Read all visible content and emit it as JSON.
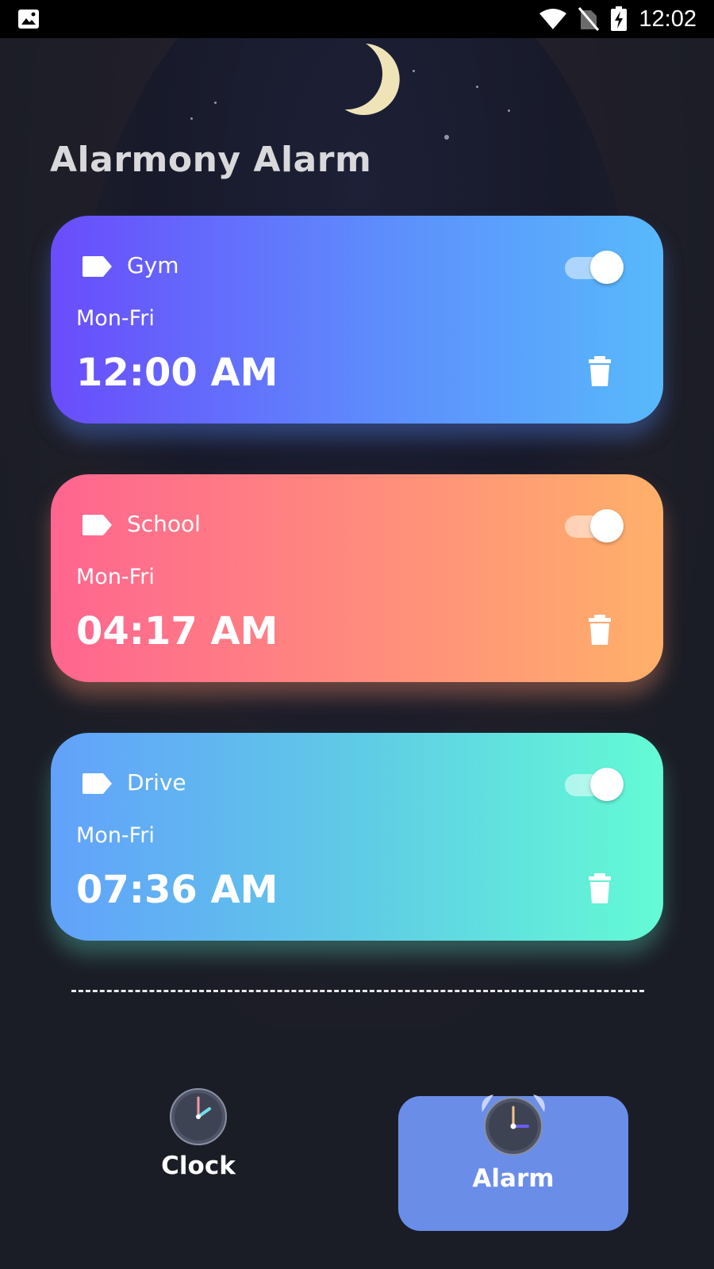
{
  "status_bar": {
    "time": "12:02",
    "icons": [
      "image-icon",
      "wifi-icon",
      "no-sim-icon",
      "battery-charging-icon"
    ]
  },
  "app": {
    "title": "Alarmony Alarm"
  },
  "alarms": [
    {
      "label": "Gym",
      "days": "Mon-Fri",
      "time": "12:00 AM",
      "enabled": true,
      "colors": [
        "#6a4cfb",
        "#58b9fb"
      ]
    },
    {
      "label": "School",
      "days": "Mon-Fri",
      "time": "04:17 AM",
      "enabled": true,
      "colors": [
        "#ff6590",
        "#ffb06a"
      ]
    },
    {
      "label": "Drive",
      "days": "Mon-Fri",
      "time": "07:36 AM",
      "enabled": true,
      "colors": [
        "#62a1fb",
        "#63fbd5"
      ]
    }
  ],
  "bottom_nav": {
    "items": [
      {
        "label": "Clock",
        "icon": "clock-icon",
        "active": false
      },
      {
        "label": "Alarm",
        "icon": "alarm-clock-icon",
        "active": true
      }
    ],
    "active_color": "#6a8de8"
  }
}
